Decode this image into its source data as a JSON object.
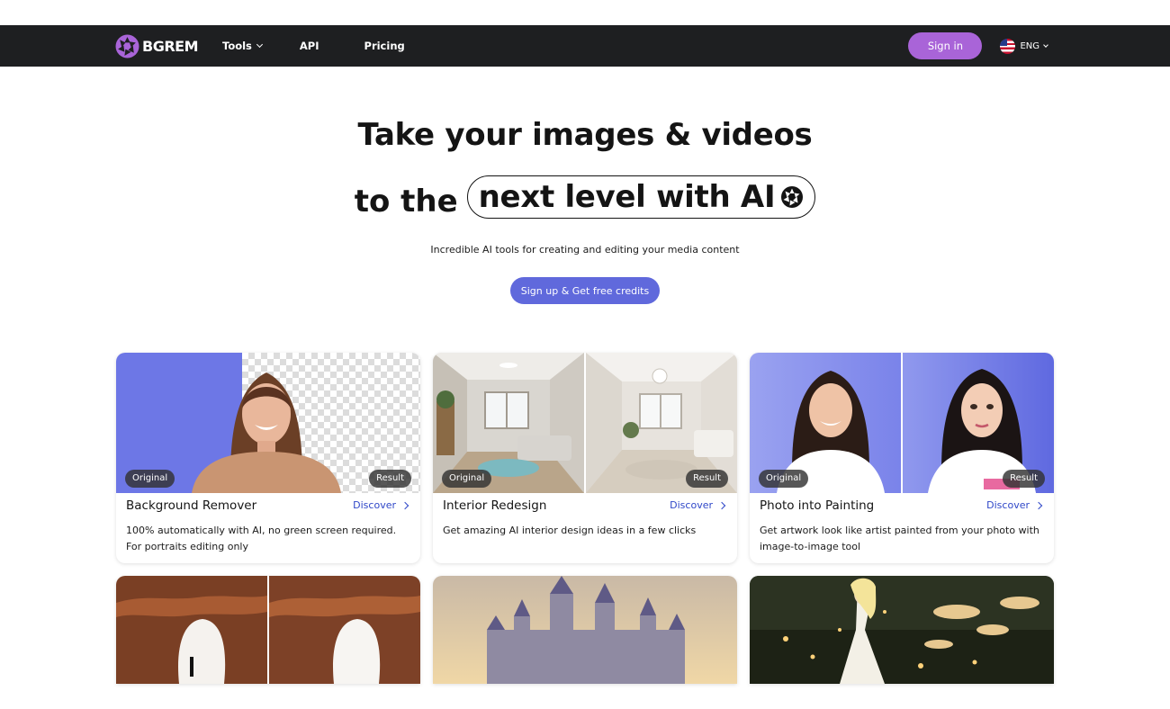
{
  "nav": {
    "logo_text": "BGREM",
    "tools_label": "Tools",
    "api_label": "API",
    "pricing_label": "Pricing",
    "signin_label": "Sign in",
    "lang_label": "ENG",
    "bg_color": "#1e1f21",
    "signin_color": "#a964d8"
  },
  "hero": {
    "line1": "Take your images & videos",
    "line2_plain": "to the",
    "line2_pill": "next level with AI",
    "subtitle": "Incredible AI tools for creating and editing your media content",
    "cta_label": "Sign up & Get free credits",
    "cta_color": "#6069dc"
  },
  "cards": [
    {
      "title": "Background Remover",
      "discover": "Discover",
      "desc": "100% automatically with AI, no green screen required. For portraits editing only",
      "badge_left": "Original",
      "badge_right": "Result"
    },
    {
      "title": "Interior Redesign",
      "discover": "Discover",
      "desc": "Get amazing AI interior design ideas in a few clicks",
      "badge_left": "Original",
      "badge_right": "Result"
    },
    {
      "title": "Photo into Painting",
      "discover": "Discover",
      "desc": "Get artwork look like artist painted from your photo with image-to-image tool",
      "badge_left": "Original",
      "badge_right": "Result"
    }
  ],
  "icons": {
    "logo": "aperture-logo-icon",
    "lang_flag": "us-flag-icon",
    "pill_icon": "aperture-icon"
  }
}
